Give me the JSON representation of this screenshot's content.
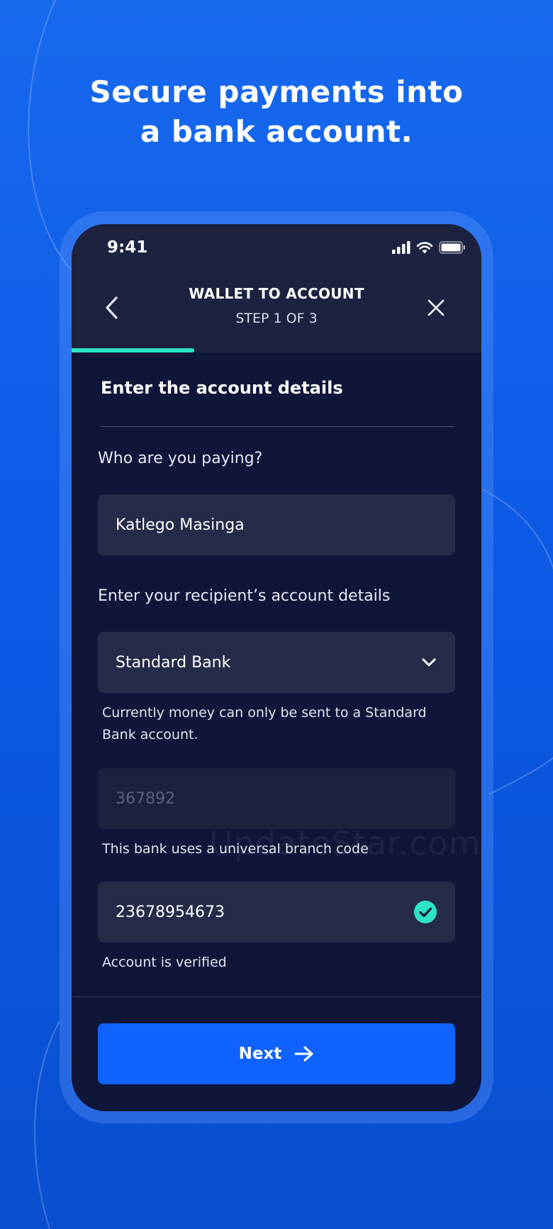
{
  "headline": {
    "line1": "Secure payments into",
    "line2": "a bank account."
  },
  "status_bar": {
    "time": "9:41",
    "icons": [
      "signal-icon",
      "wifi-icon",
      "battery-icon"
    ]
  },
  "header": {
    "title": "WALLET TO ACCOUNT",
    "step": "STEP 1 OF 3",
    "back_icon": "chevron-left-icon",
    "close_icon": "close-icon"
  },
  "progress": {
    "current_step": 1,
    "total_steps": 3,
    "fraction": 0.3
  },
  "form": {
    "title": "Enter the account details",
    "payee_label": "Who are you paying?",
    "payee_value": "Katlego Masinga",
    "account_label": "Enter your recipient’s account details",
    "bank_value": "Standard Bank",
    "bank_helper": "Currently money can only be sent to a Standard Bank account.",
    "branch_code": "367892",
    "branch_helper": "This bank uses a universal branch code",
    "account_number": "23678954673",
    "account_helper": "Account is verified"
  },
  "next_button": {
    "label": "Next",
    "icon": "arrow-right-icon"
  },
  "watermark": "UpdateStar.com",
  "colors": {
    "background": "#1769ee",
    "phone": "#10163a",
    "field": "#262b4a",
    "accent": "#2de3c4",
    "primary_button": "#0f62fe"
  }
}
